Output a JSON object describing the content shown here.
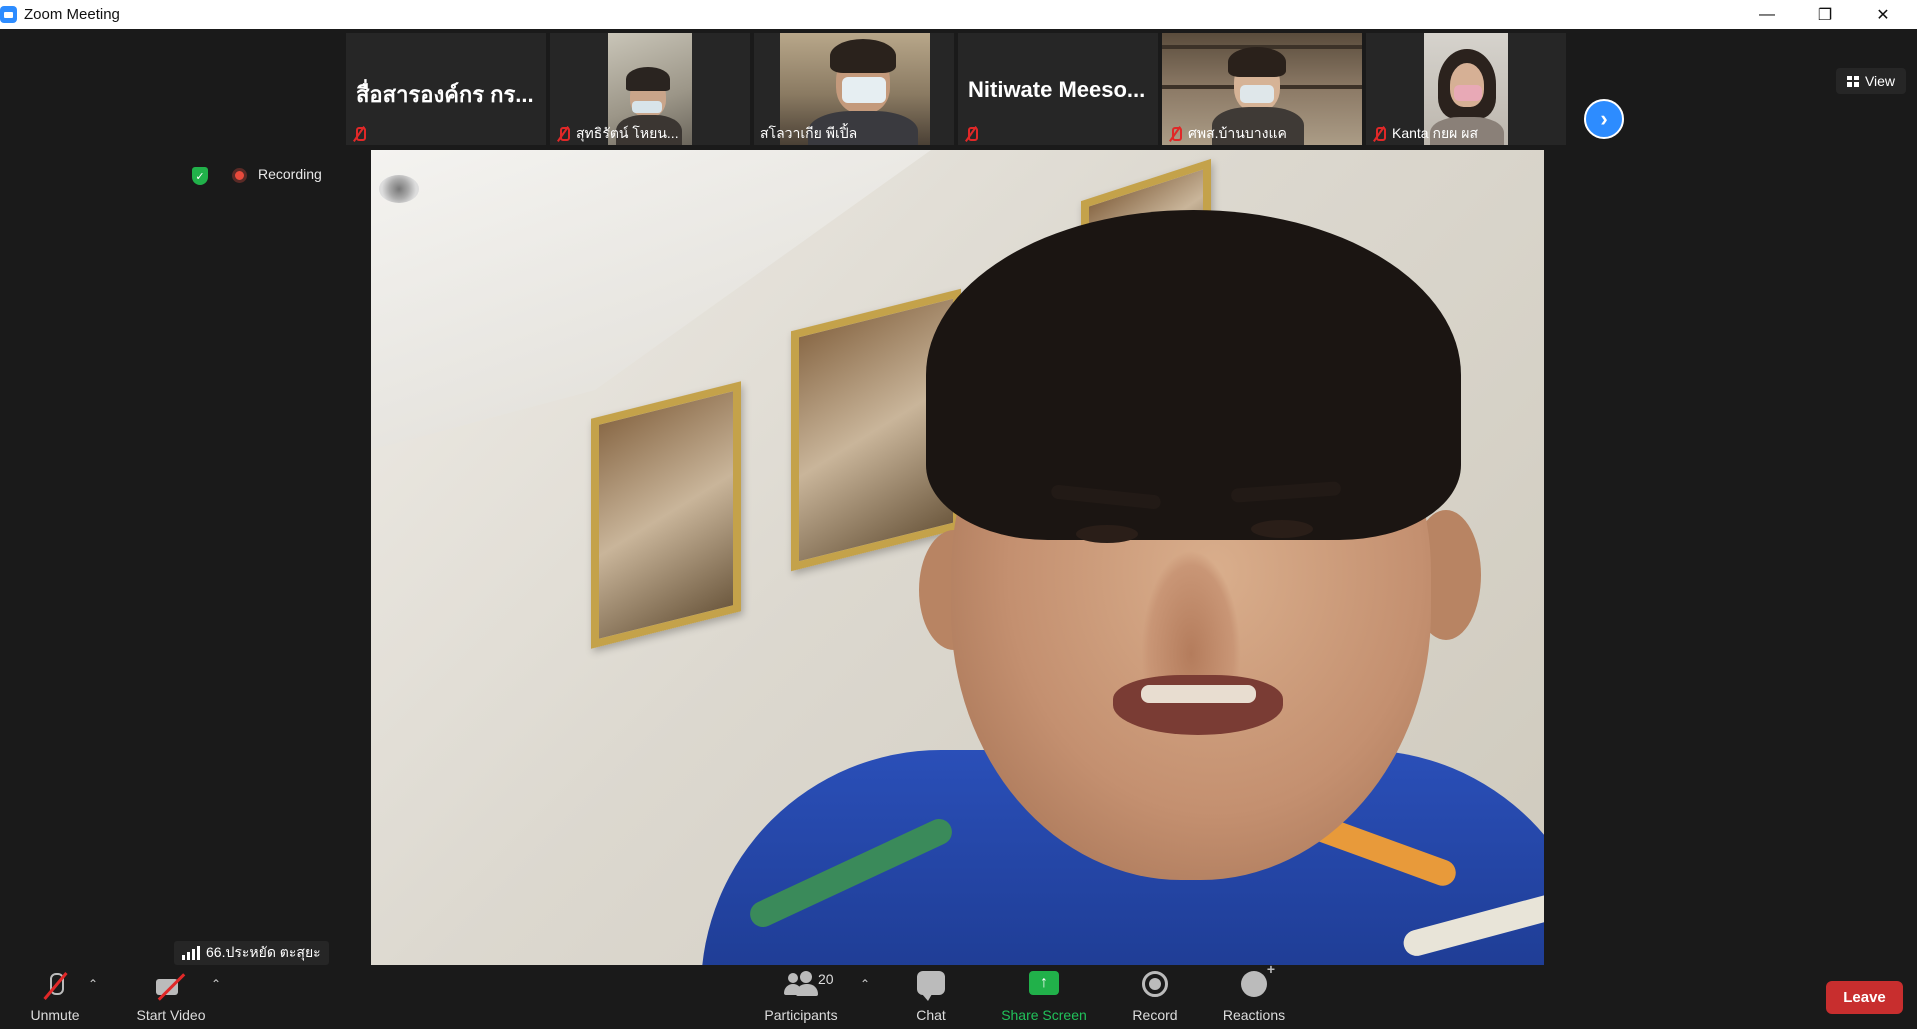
{
  "window": {
    "title": "Zoom Meeting"
  },
  "thumbnails": [
    {
      "name": "สื่อสารองค์กร กร...",
      "muted": true,
      "video": false
    },
    {
      "name": "สุทธิรัตน์ โหยน...",
      "muted": true,
      "video": true
    },
    {
      "name": "สโลวาเกีย พีเปิ้ล",
      "muted": false,
      "video": true
    },
    {
      "name": "Nitiwate  Meeso...",
      "muted": true,
      "video": false
    },
    {
      "name": "ศพส.บ้านบางแค",
      "muted": true,
      "video": true
    },
    {
      "name": "Kanta กยผ ผส",
      "muted": true,
      "video": true
    }
  ],
  "view_label": "View",
  "recording_label": "Recording",
  "active_speaker_label": "66.ประหยัด ตะสุยะ",
  "toolbar": {
    "unmute": "Unmute",
    "start_video": "Start Video",
    "participants": "Participants",
    "participant_count": "20",
    "chat": "Chat",
    "share_screen": "Share Screen",
    "record": "Record",
    "reactions": "Reactions",
    "leave": "Leave"
  },
  "colors": {
    "accent": "#2d8cff",
    "share": "#21b14a",
    "leave": "#c82e2e",
    "muted": "#e02828"
  }
}
